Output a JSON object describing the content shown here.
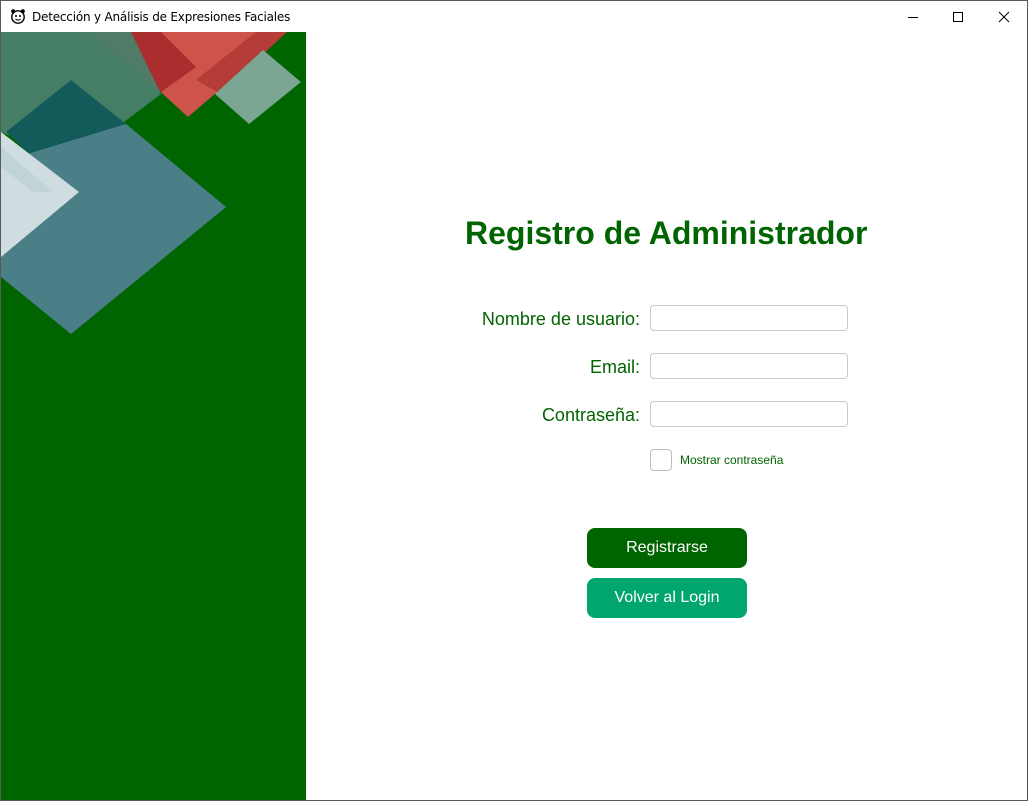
{
  "window": {
    "title": "Detección y Análisis de Expresiones Faciales",
    "controls": [
      "minimize",
      "maximize",
      "close"
    ]
  },
  "form": {
    "heading": "Registro de Administrador",
    "fields": [
      {
        "label": "Nombre de usuario:",
        "value": "",
        "placeholder": ""
      },
      {
        "label": "Email:",
        "value": "",
        "placeholder": ""
      },
      {
        "label": "Contraseña:",
        "value": "",
        "placeholder": ""
      }
    ],
    "show_password": {
      "label": "Mostrar contraseña",
      "checked": false
    },
    "register_button": "Registrarse",
    "back_button": "Volver al Login"
  },
  "colors": {
    "primary_green": "#006400",
    "secondary_green": "#00a66e",
    "accent_red": "#d9534f",
    "accent_teal": "#4a7f88"
  },
  "icons": {
    "app": "face-emoji-icon",
    "minimize": "minimize-icon",
    "maximize": "maximize-icon",
    "close": "close-icon"
  }
}
